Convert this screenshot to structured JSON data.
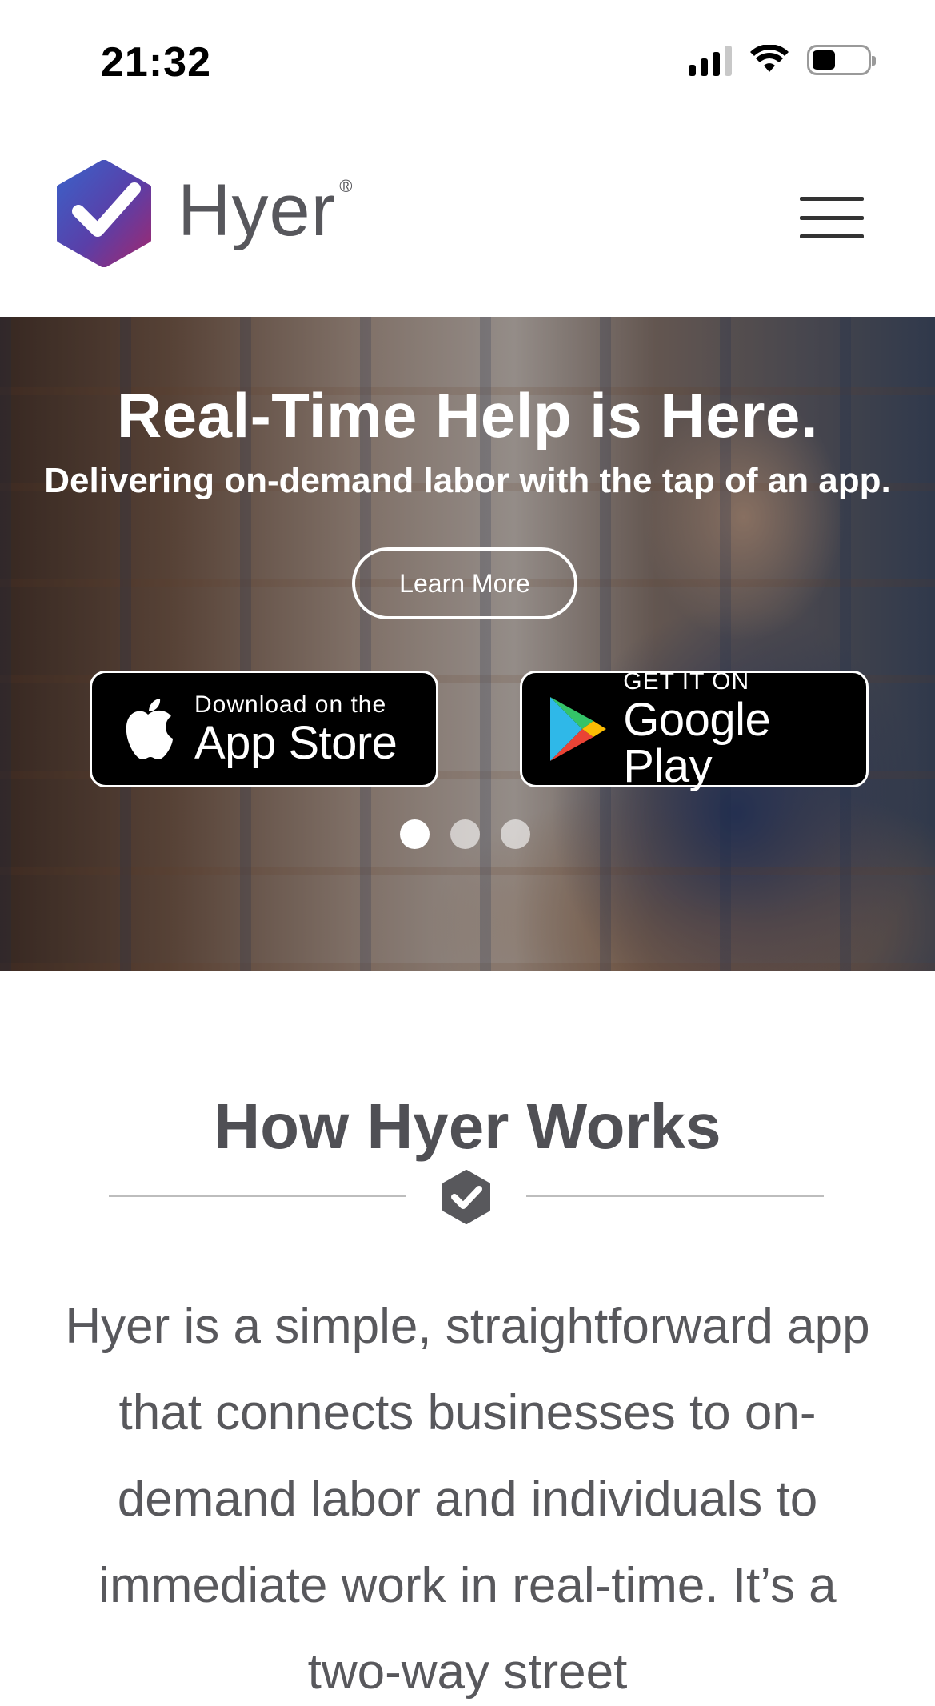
{
  "status_bar": {
    "time": "21:32"
  },
  "header": {
    "logo_text": "Hyer",
    "logo_mark": "®"
  },
  "hero": {
    "title": "Real-Time Help is Here.",
    "subtitle": "Delivering on-demand labor with the tap of an app.",
    "cta_label": "Learn More",
    "app_store": {
      "small": "Download on the",
      "big": "App Store"
    },
    "google_play": {
      "small": "GET IT ON",
      "big": "Google Play"
    },
    "slide_count": 3,
    "active_slide": 1
  },
  "how_it_works": {
    "title": "How Hyer Works",
    "body": "Hyer is a simple, straightforward app that connects businesses to on-demand labor and individuals to immediate work in real-time. It’s a two-way street"
  },
  "colors": {
    "brand_blue": "#3b5fc0",
    "brand_purple": "#8a2a7a",
    "text_gray": "#57575c"
  },
  "icons": [
    "signal-icon",
    "wifi-icon",
    "battery-icon",
    "hyer-logo-icon",
    "menu-icon",
    "apple-icon",
    "google-play-icon",
    "check-badge-icon"
  ]
}
